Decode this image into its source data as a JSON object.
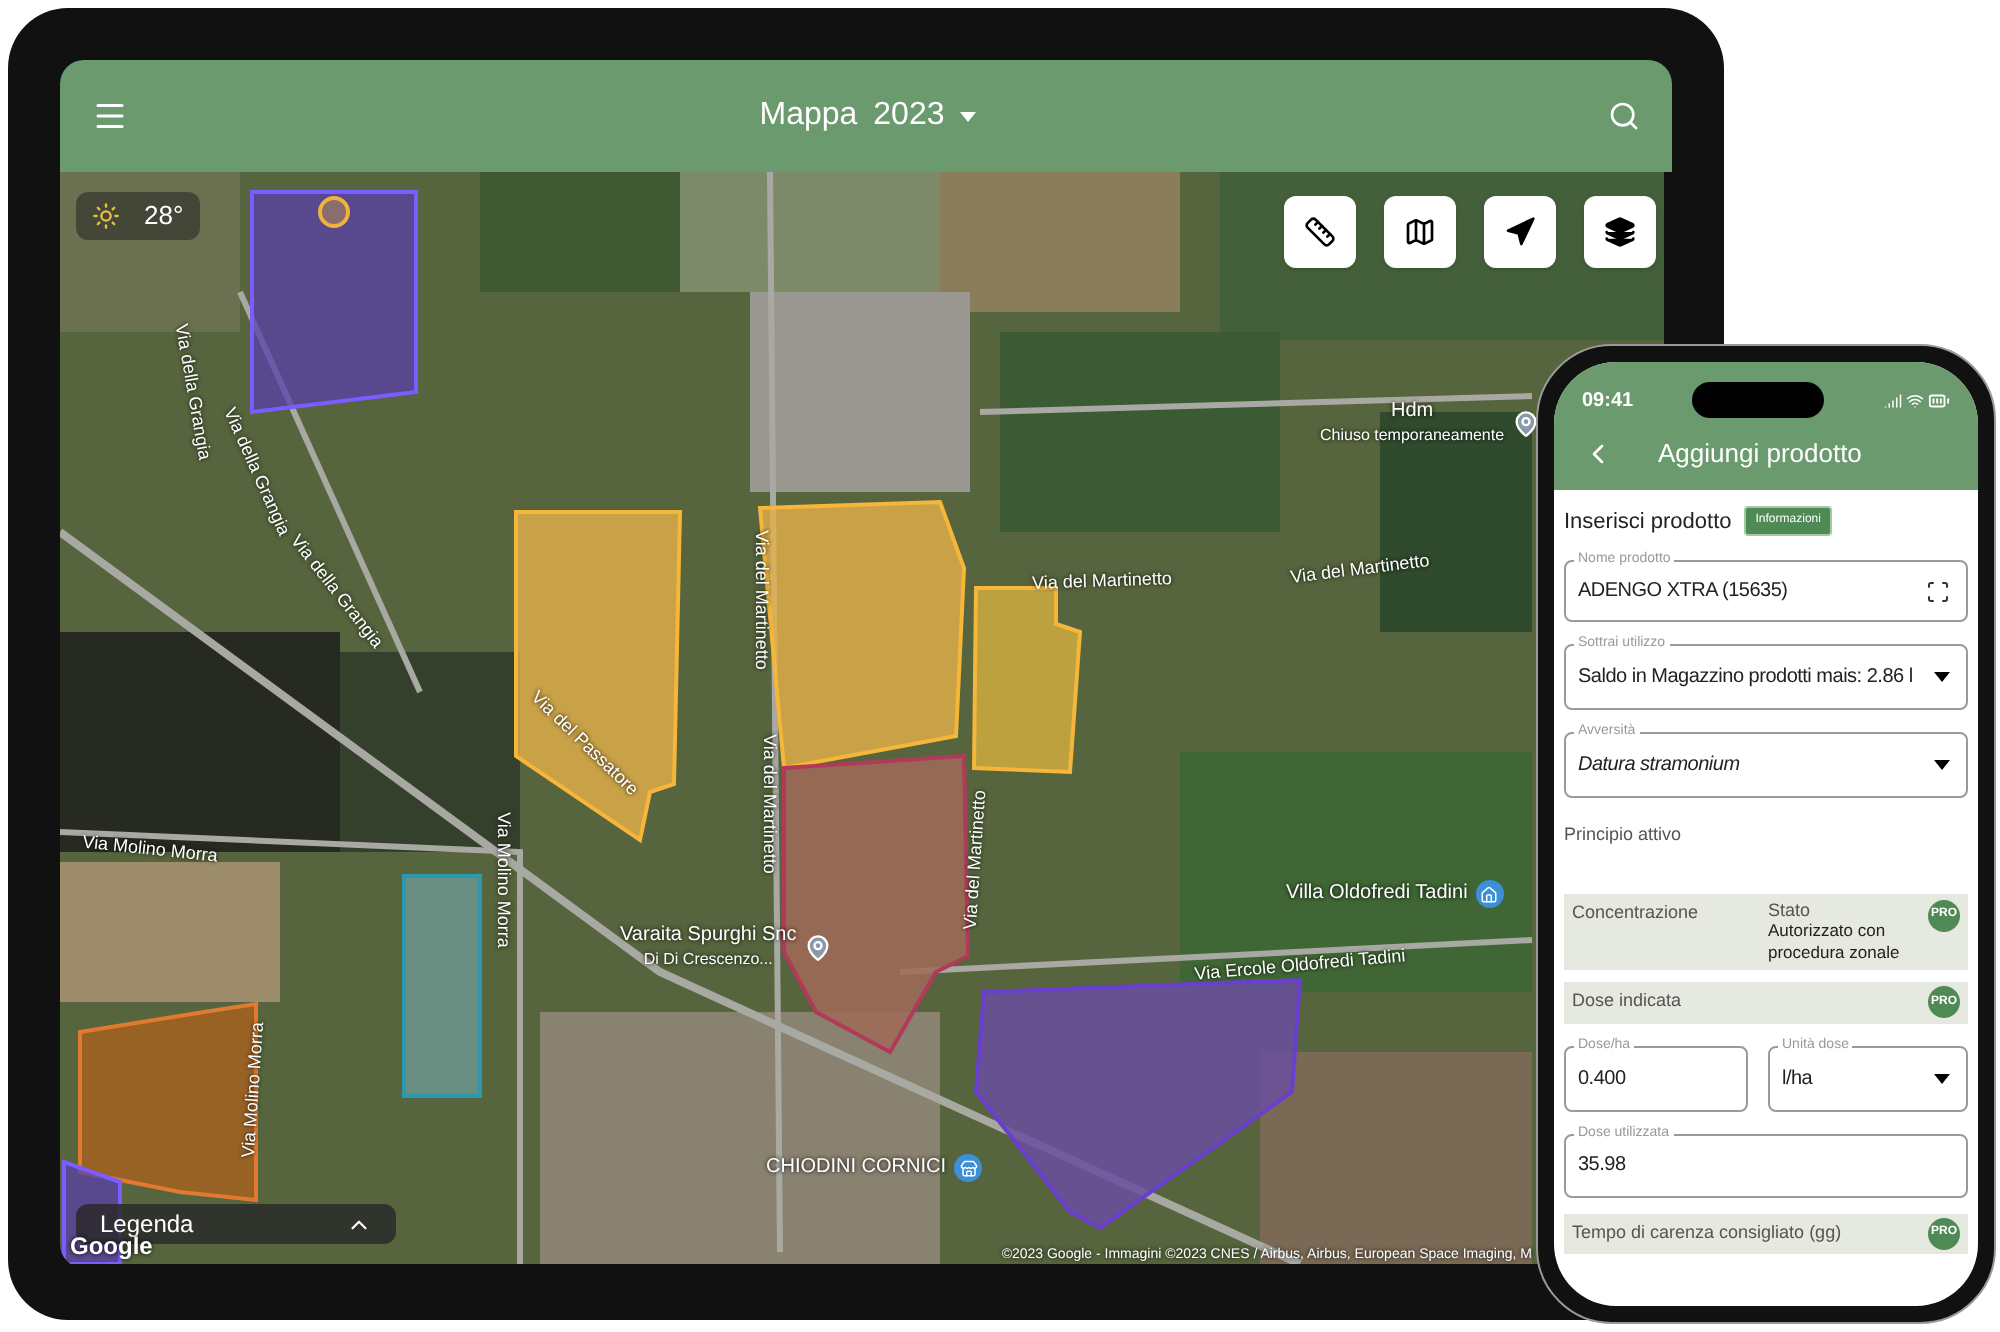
{
  "tablet": {
    "header": {
      "title": "Mappa",
      "year": "2023"
    },
    "weather": {
      "temperature": "28°"
    },
    "places": [
      {
        "kind": "place",
        "name": "Hdm",
        "note": "Chiuso temporaneamente"
      },
      {
        "kind": "home",
        "name": "Villa Oldofredi Tadini"
      },
      {
        "kind": "place",
        "name": "Varaita Spurghi Snc",
        "note": "Di Di Crescenzo..."
      },
      {
        "kind": "shop",
        "name": "CHIODINI CORNICI"
      }
    ],
    "streets": [
      {
        "name": "Via della Grangia"
      },
      {
        "name": "Via della Grangia"
      },
      {
        "name": "Via della Grangia"
      },
      {
        "name": "Via del Passatore"
      },
      {
        "name": "Via del Martinetto"
      },
      {
        "name": "Via del Martinetto"
      },
      {
        "name": "Via del Martinetto"
      },
      {
        "name": "Via del Martinetto"
      },
      {
        "name": "Via Molino Morra"
      },
      {
        "name": "Via Molino Morra"
      },
      {
        "name": "Via Molino Morra"
      },
      {
        "name": "Via Ercole Oldofredi Tadini"
      },
      {
        "name": "Via del Martinetto"
      }
    ],
    "legend": {
      "label": "Legenda",
      "expanded": false
    },
    "attribution": {
      "logo": "Google",
      "copyright": "©2023 Google - Immagini ©2023 CNES / Airbus, Airbus, European Space Imaging, M"
    }
  },
  "phone": {
    "status_bar": {
      "time": "09:41"
    },
    "title": "Aggiungi prodotto",
    "section": {
      "title": "Inserisci prodotto",
      "badge": "Informazioni"
    },
    "product_field": {
      "label": "Nome prodotto",
      "value": "ADENGO XTRA (15635)"
    },
    "subtract_field": {
      "label": "Sottrai utilizzo",
      "value": "Saldo in Magazzino prodotti mais: 2.86 l"
    },
    "adversity_field": {
      "label": "Avversità",
      "value": "Datura stramonium"
    },
    "active_ingredient_label": "Principio attivo",
    "info_panel": {
      "concentration_label": "Concentrazione",
      "status_label": "Stato",
      "status_value": "Autorizzato con procedura zonale",
      "badge": "PRO"
    },
    "indicated_dose": {
      "label": "Dose indicata",
      "badge": "PRO"
    },
    "dose_per_ha": {
      "label": "Dose/ha",
      "value": "0.400"
    },
    "dose_unit": {
      "label": "Unità dose",
      "value": "l/ha"
    },
    "used_dose": {
      "label": "Dose utilizzata",
      "value": "35.98"
    },
    "withdrawal": {
      "label": "Tempo di carenza consigliato (gg)",
      "badge": "PRO"
    }
  }
}
